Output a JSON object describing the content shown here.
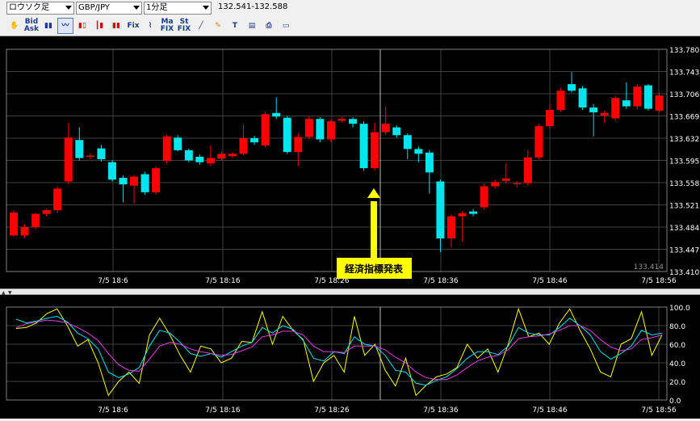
{
  "toolbar": {
    "chart_type": "ロウソク足",
    "pair": "GBP/JPY",
    "timeframe": "1分足",
    "range": "132.541-132.588",
    "icons": [
      "hand-icon",
      "bid-ask-icon",
      "bar-chart-icon",
      "line-chart-icon",
      "candle-icon",
      "candle-alt-icon",
      "candle-color-icon",
      "fix-icon",
      "fix-line-icon",
      "ma-fix-icon",
      "stochastic-fix-icon",
      "trend-line-icon",
      "pen-icon",
      "text-icon",
      "settings-icon",
      "print-icon",
      "window-icon"
    ]
  },
  "colors": {
    "up": "#ff0000",
    "down": "#00e5ee",
    "background": "#000000",
    "grid": "#404040",
    "axis_text": "#ffffff",
    "annotation_bg": "#ffff00",
    "line_yellow": "#ffff00",
    "line_cyan": "#00e5ee",
    "line_magenta": "#e040e0"
  },
  "annotation": {
    "label": "経済指標発表"
  },
  "main_chart": {
    "y_ticks": [
      "133.780",
      "133.743",
      "133.706",
      "133.669",
      "133.632",
      "133.595",
      "133.558",
      "133.521",
      "133.484",
      "133.447",
      "133.410"
    ],
    "current_price": "133.414",
    "x_ticks": [
      "7/5 18:6",
      "7/5 18:16",
      "7/5 18:26",
      "7/5 18:36",
      "7/5 18:46",
      "7/5 18:56"
    ]
  },
  "sub_chart": {
    "y_ticks": [
      "100.0",
      "80.0",
      "60.0",
      "40.0",
      "20.0",
      "0.0"
    ],
    "x_ticks": [
      "7/5 18:6",
      "7/5 18:16",
      "7/5 18:26",
      "7/5 18:36",
      "7/5 18:46",
      "7/5 18:56"
    ]
  },
  "chart_data": [
    {
      "type": "candlestick",
      "ylim": [
        133.41,
        133.78
      ],
      "candles": [
        {
          "o": 133.47,
          "c": 133.508,
          "h": 133.512,
          "l": 133.468
        },
        {
          "o": 133.47,
          "c": 133.484,
          "h": 133.488,
          "l": 133.466
        },
        {
          "o": 133.484,
          "c": 133.506,
          "h": 133.508,
          "l": 133.48
        },
        {
          "o": 133.506,
          "c": 133.512,
          "h": 133.514,
          "l": 133.502
        },
        {
          "o": 133.512,
          "c": 133.548,
          "h": 133.552,
          "l": 133.508
        },
        {
          "o": 133.56,
          "c": 133.633,
          "h": 133.657,
          "l": 133.556
        },
        {
          "o": 133.629,
          "c": 133.599,
          "h": 133.65,
          "l": 133.595
        },
        {
          "o": 133.601,
          "c": 133.603,
          "h": 133.607,
          "l": 133.597
        },
        {
          "o": 133.615,
          "c": 133.597,
          "h": 133.621,
          "l": 133.593
        },
        {
          "o": 133.592,
          "c": 133.563,
          "h": 133.595,
          "l": 133.56
        },
        {
          "o": 133.566,
          "c": 133.555,
          "h": 133.57,
          "l": 133.525
        },
        {
          "o": 133.553,
          "c": 133.568,
          "h": 133.57,
          "l": 133.523
        },
        {
          "o": 133.572,
          "c": 133.542,
          "h": 133.576,
          "l": 133.538
        },
        {
          "o": 133.542,
          "c": 133.582,
          "h": 133.585,
          "l": 133.538
        },
        {
          "o": 133.594,
          "c": 133.635,
          "h": 133.638,
          "l": 133.59
        },
        {
          "o": 133.633,
          "c": 133.612,
          "h": 133.637,
          "l": 133.61
        },
        {
          "o": 133.612,
          "c": 133.595,
          "h": 133.615,
          "l": 133.592
        },
        {
          "o": 133.601,
          "c": 133.592,
          "h": 133.605,
          "l": 133.588
        },
        {
          "o": 133.59,
          "c": 133.599,
          "h": 133.62,
          "l": 133.586
        },
        {
          "o": 133.598,
          "c": 133.606,
          "h": 133.61,
          "l": 133.595
        },
        {
          "o": 133.602,
          "c": 133.606,
          "h": 133.609,
          "l": 133.599
        },
        {
          "o": 133.606,
          "c": 133.632,
          "h": 133.655,
          "l": 133.603
        },
        {
          "o": 133.632,
          "c": 133.625,
          "h": 133.636,
          "l": 133.621
        },
        {
          "o": 133.62,
          "c": 133.672,
          "h": 133.676,
          "l": 133.617
        },
        {
          "o": 133.674,
          "c": 133.668,
          "h": 133.7,
          "l": 133.664
        },
        {
          "o": 133.666,
          "c": 133.609,
          "h": 133.669,
          "l": 133.606
        },
        {
          "o": 133.609,
          "c": 133.634,
          "h": 133.64,
          "l": 133.585
        },
        {
          "o": 133.634,
          "c": 133.664,
          "h": 133.669,
          "l": 133.63
        },
        {
          "o": 133.664,
          "c": 133.63,
          "h": 133.667,
          "l": 133.625
        },
        {
          "o": 133.63,
          "c": 133.66,
          "h": 133.663,
          "l": 133.625
        },
        {
          "o": 133.661,
          "c": 133.664,
          "h": 133.667,
          "l": 133.658
        },
        {
          "o": 133.664,
          "c": 133.656,
          "h": 133.667,
          "l": 133.65
        },
        {
          "o": 133.656,
          "c": 133.582,
          "h": 133.66,
          "l": 133.578
        },
        {
          "o": 133.582,
          "c": 133.642,
          "h": 133.658,
          "l": 133.578
        },
        {
          "o": 133.642,
          "c": 133.656,
          "h": 133.685,
          "l": 133.638
        },
        {
          "o": 133.65,
          "c": 133.637,
          "h": 133.653,
          "l": 133.633
        },
        {
          "o": 133.637,
          "c": 133.614,
          "h": 133.64,
          "l": 133.597
        },
        {
          "o": 133.614,
          "c": 133.606,
          "h": 133.618,
          "l": 133.592
        },
        {
          "o": 133.608,
          "c": 133.575,
          "h": 133.612,
          "l": 133.54
        },
        {
          "o": 133.56,
          "c": 133.465,
          "h": 133.563,
          "l": 133.442
        },
        {
          "o": 133.465,
          "c": 133.502,
          "h": 133.505,
          "l": 133.45
        },
        {
          "o": 133.502,
          "c": 133.507,
          "h": 133.51,
          "l": 133.46
        },
        {
          "o": 133.51,
          "c": 133.506,
          "h": 133.514,
          "l": 133.502
        },
        {
          "o": 133.517,
          "c": 133.552,
          "h": 133.556,
          "l": 133.513
        },
        {
          "o": 133.552,
          "c": 133.559,
          "h": 133.563,
          "l": 133.548
        },
        {
          "o": 133.561,
          "c": 133.565,
          "h": 133.59,
          "l": 133.557
        },
        {
          "o": 133.557,
          "c": 133.557,
          "h": 133.561,
          "l": 133.55
        },
        {
          "o": 133.557,
          "c": 133.6,
          "h": 133.612,
          "l": 133.553
        },
        {
          "o": 133.6,
          "c": 133.652,
          "h": 133.656,
          "l": 133.597
        },
        {
          "o": 133.652,
          "c": 133.679,
          "h": 133.69,
          "l": 133.648
        },
        {
          "o": 133.679,
          "c": 133.711,
          "h": 133.715,
          "l": 133.676
        },
        {
          "o": 133.722,
          "c": 133.711,
          "h": 133.742,
          "l": 133.708
        },
        {
          "o": 133.715,
          "c": 133.683,
          "h": 133.719,
          "l": 133.679
        },
        {
          "o": 133.683,
          "c": 133.675,
          "h": 133.689,
          "l": 133.635
        },
        {
          "o": 133.67,
          "c": 133.674,
          "h": 133.678,
          "l": 133.657
        },
        {
          "o": 133.665,
          "c": 133.699,
          "h": 133.702,
          "l": 133.662
        },
        {
          "o": 133.695,
          "c": 133.685,
          "h": 133.725,
          "l": 133.681
        },
        {
          "o": 133.685,
          "c": 133.718,
          "h": 133.722,
          "l": 133.68
        },
        {
          "o": 133.72,
          "c": 133.681,
          "h": 133.722,
          "l": 133.678
        },
        {
          "o": 133.678,
          "c": 133.703,
          "h": 133.708,
          "l": 133.675
        }
      ]
    },
    {
      "type": "line",
      "ylim": [
        0,
        100
      ],
      "series": [
        {
          "color": "yellow",
          "values": [
            77,
            78,
            83,
            93,
            98,
            80,
            58,
            65,
            40,
            5,
            20,
            30,
            18,
            70,
            88,
            70,
            48,
            30,
            58,
            55,
            40,
            45,
            63,
            62,
            95,
            60,
            90,
            75,
            65,
            20,
            40,
            48,
            30,
            90,
            48,
            60,
            32,
            15,
            45,
            5,
            16,
            25,
            28,
            35,
            60,
            45,
            55,
            30,
            60,
            98,
            68,
            72,
            60,
            83,
            98,
            75,
            55,
            30,
            25,
            60,
            66,
            95,
            48,
            70
          ]
        },
        {
          "color": "cyan",
          "values": [
            87,
            83,
            85,
            88,
            90,
            84,
            72,
            66,
            55,
            30,
            24,
            28,
            35,
            58,
            75,
            72,
            62,
            50,
            47,
            50,
            46,
            52,
            58,
            62,
            78,
            72,
            80,
            76,
            64,
            45,
            42,
            52,
            50,
            68,
            60,
            58,
            48,
            32,
            30,
            18,
            16,
            21,
            25,
            34,
            45,
            52,
            52,
            49,
            58,
            78,
            72,
            70,
            70,
            78,
            88,
            80,
            70,
            52,
            44,
            50,
            58,
            75,
            70,
            72
          ]
        },
        {
          "color": "magenta",
          "values": [
            78,
            82,
            84,
            86,
            85,
            83,
            78,
            72,
            64,
            50,
            38,
            32,
            31,
            44,
            58,
            62,
            60,
            55,
            52,
            50,
            48,
            49,
            53,
            57,
            68,
            70,
            74,
            74,
            70,
            58,
            52,
            52,
            51,
            58,
            58,
            58,
            54,
            46,
            40,
            30,
            24,
            22,
            22,
            27,
            35,
            42,
            46,
            48,
            54,
            66,
            68,
            69,
            71,
            75,
            80,
            80,
            75,
            65,
            57,
            53,
            55,
            65,
            67,
            70
          ]
        }
      ]
    }
  ]
}
